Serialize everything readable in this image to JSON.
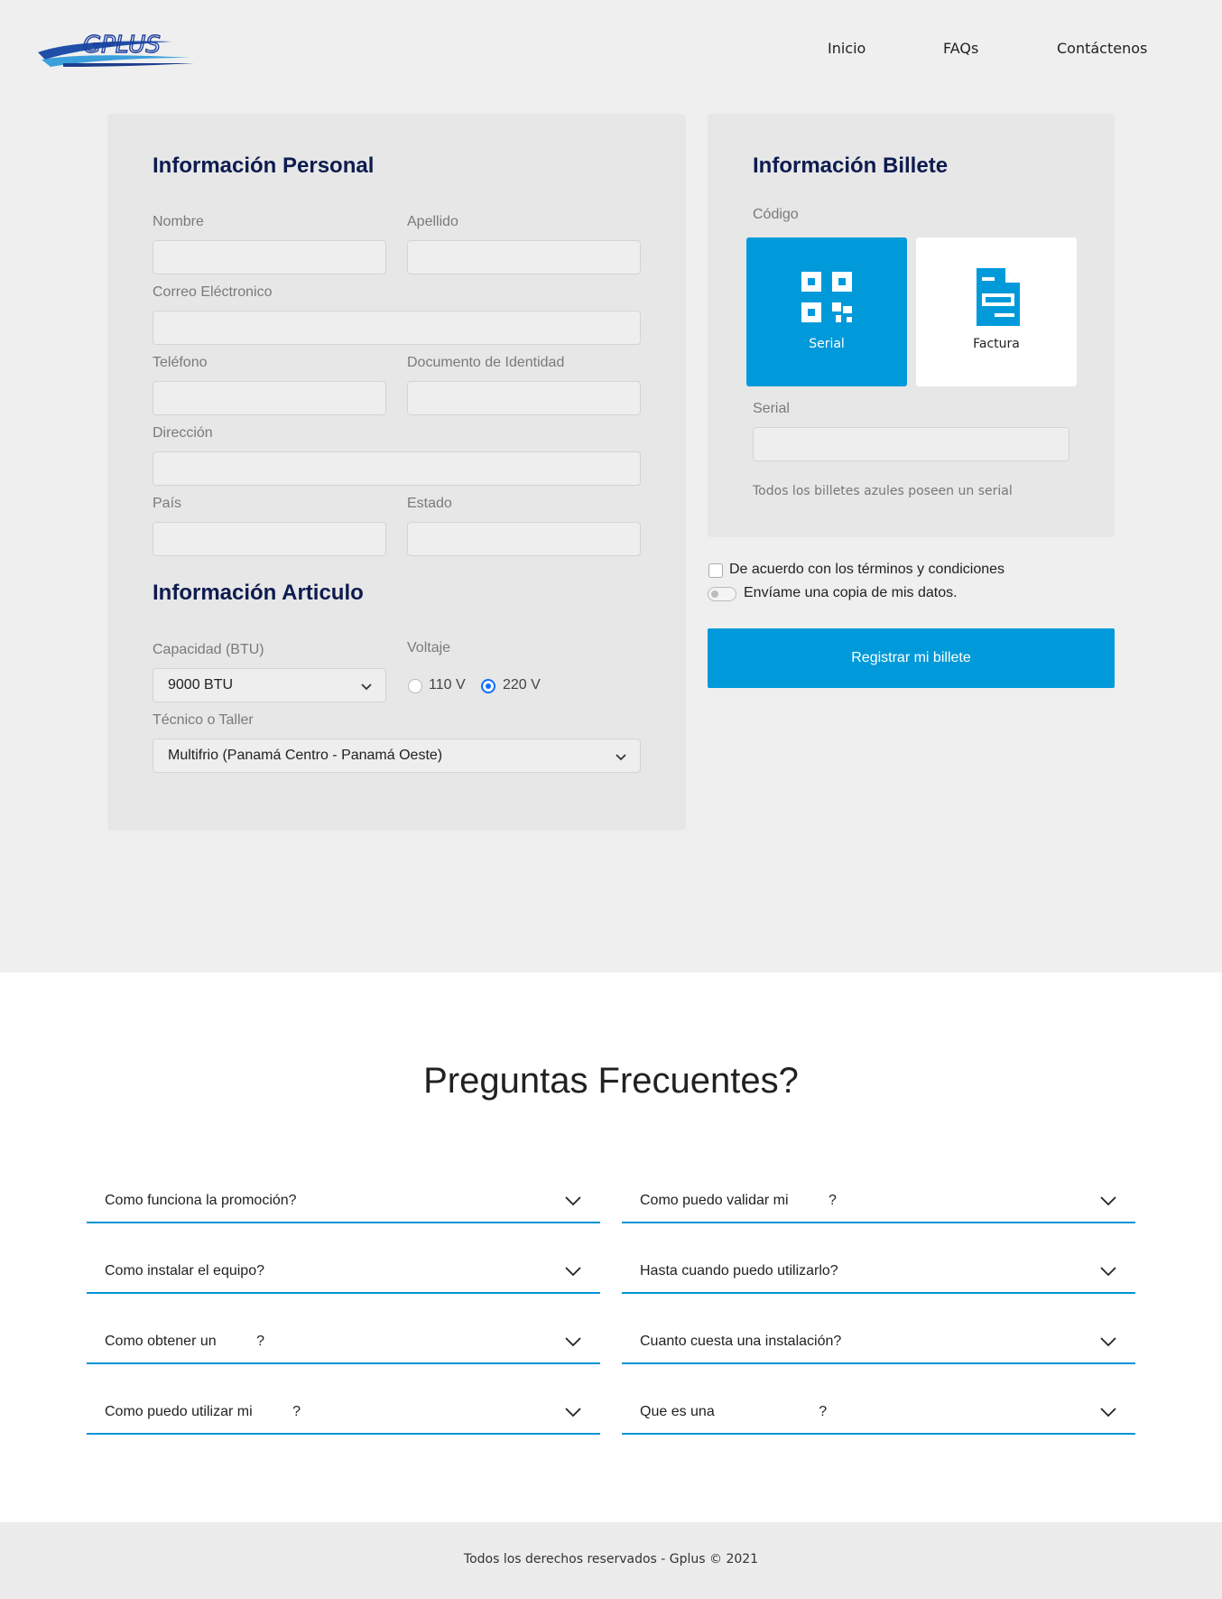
{
  "brand": {
    "logo_text": "GPLUS"
  },
  "nav": {
    "inicio": "Inicio",
    "faqs": "FAQs",
    "contact": "Contáctenos"
  },
  "personal": {
    "title": "Información Personal",
    "nombre_label": "Nombre",
    "apellido_label": "Apellido",
    "email_label": "Correo Eléctronico",
    "telefono_label": "Teléfono",
    "documento_label": "Documento de Identidad",
    "direccion_label": "Dirección",
    "pais_label": "País",
    "estado_label": "Estado"
  },
  "articulo": {
    "title": "Información Articulo",
    "capacidad_label": "Capacidad (BTU)",
    "capacidad_value": "9000 BTU",
    "voltaje_label": "Voltaje",
    "voltaje_options": [
      "110 V",
      "220 V"
    ],
    "voltaje_selected": "220 V",
    "tecnico_label": "Técnico o Taller",
    "tecnico_value": "Multifrio (Panamá Centro - Panamá Oeste)"
  },
  "billete": {
    "title": "Información Billete",
    "codigo_label": "Código",
    "options": [
      {
        "label": "Serial",
        "icon": "qr-code-icon",
        "active": true
      },
      {
        "label": "Factura",
        "icon": "invoice-icon",
        "active": false
      }
    ],
    "serial_label": "Serial",
    "hint": "Todos los billetes azules poseen un serial"
  },
  "agreement": {
    "terms_label": "De acuerdo con los términos y condiciones",
    "copy_label": "Envíame una copia de mis datos.",
    "terms_checked": false,
    "copy_on": false
  },
  "submit_label": "Registrar mi billete",
  "faq": {
    "title": "Preguntas Frecuentes?",
    "items": [
      "Como funciona la promoción?",
      "Como puedo validar mi          ?",
      "Como instalar el equipo?",
      "Hasta cuando puedo utilizarlo?",
      "Como obtener un          ?",
      "Cuanto cuesta una instalación?",
      "Como puedo utilizar mi          ?",
      "Que es una                          ?"
    ]
  },
  "footer": {
    "text": "Todos los derechos reservados - Gplus © 2021"
  },
  "colors": {
    "accent": "#009ada",
    "title": "#0d1b4f",
    "radio": "#0d6efd"
  }
}
